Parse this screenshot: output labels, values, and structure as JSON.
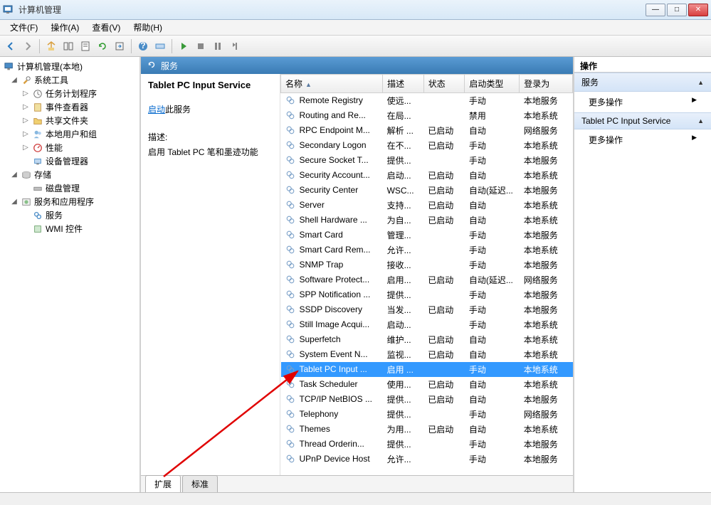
{
  "window": {
    "title": "计算机管理"
  },
  "menu": {
    "file": "文件(F)",
    "action": "操作(A)",
    "view": "查看(V)",
    "help": "帮助(H)"
  },
  "tree": {
    "root": "计算机管理(本地)",
    "system_tools": "系统工具",
    "task_scheduler": "任务计划程序",
    "event_viewer": "事件查看器",
    "shared_folders": "共享文件夹",
    "local_users": "本地用户和组",
    "performance": "性能",
    "device_manager": "设备管理器",
    "storage": "存储",
    "disk_mgmt": "磁盘管理",
    "services_apps": "服务和应用程序",
    "services": "服务",
    "wmi": "WMI 控件"
  },
  "center": {
    "header": "服务",
    "selected_title": "Tablet PC Input Service",
    "start_link": "启动",
    "start_suffix": "此服务",
    "desc_label": "描述:",
    "desc_text": "启用 Tablet PC 笔和墨迹功能"
  },
  "columns": {
    "name": "名称",
    "desc": "描述",
    "status": "状态",
    "startup": "启动类型",
    "logon": "登录为"
  },
  "services": [
    {
      "name": "Remote Registry",
      "desc": "使远...",
      "status": "",
      "startup": "手动",
      "logon": "本地服务",
      "sel": false
    },
    {
      "name": "Routing and Re...",
      "desc": "在局...",
      "status": "",
      "startup": "禁用",
      "logon": "本地系统",
      "sel": false
    },
    {
      "name": "RPC Endpoint M...",
      "desc": "解析 ...",
      "status": "已启动",
      "startup": "自动",
      "logon": "网络服务",
      "sel": false
    },
    {
      "name": "Secondary Logon",
      "desc": "在不...",
      "status": "已启动",
      "startup": "手动",
      "logon": "本地系统",
      "sel": false
    },
    {
      "name": "Secure Socket T...",
      "desc": "提供...",
      "status": "",
      "startup": "手动",
      "logon": "本地服务",
      "sel": false
    },
    {
      "name": "Security Account...",
      "desc": "启动...",
      "status": "已启动",
      "startup": "自动",
      "logon": "本地系统",
      "sel": false
    },
    {
      "name": "Security Center",
      "desc": "WSC...",
      "status": "已启动",
      "startup": "自动(延迟...",
      "logon": "本地服务",
      "sel": false
    },
    {
      "name": "Server",
      "desc": "支持...",
      "status": "已启动",
      "startup": "自动",
      "logon": "本地系统",
      "sel": false
    },
    {
      "name": "Shell Hardware ...",
      "desc": "为自...",
      "status": "已启动",
      "startup": "自动",
      "logon": "本地系统",
      "sel": false
    },
    {
      "name": "Smart Card",
      "desc": "管理...",
      "status": "",
      "startup": "手动",
      "logon": "本地服务",
      "sel": false
    },
    {
      "name": "Smart Card Rem...",
      "desc": "允许...",
      "status": "",
      "startup": "手动",
      "logon": "本地系统",
      "sel": false
    },
    {
      "name": "SNMP Trap",
      "desc": "接收...",
      "status": "",
      "startup": "手动",
      "logon": "本地服务",
      "sel": false
    },
    {
      "name": "Software Protect...",
      "desc": "启用...",
      "status": "已启动",
      "startup": "自动(延迟...",
      "logon": "网络服务",
      "sel": false
    },
    {
      "name": "SPP Notification ...",
      "desc": "提供...",
      "status": "",
      "startup": "手动",
      "logon": "本地服务",
      "sel": false
    },
    {
      "name": "SSDP Discovery",
      "desc": "当发...",
      "status": "已启动",
      "startup": "手动",
      "logon": "本地服务",
      "sel": false
    },
    {
      "name": "Still Image Acqui...",
      "desc": "启动...",
      "status": "",
      "startup": "手动",
      "logon": "本地系统",
      "sel": false
    },
    {
      "name": "Superfetch",
      "desc": "维护...",
      "status": "已启动",
      "startup": "自动",
      "logon": "本地系统",
      "sel": false
    },
    {
      "name": "System Event N...",
      "desc": "监视...",
      "status": "已启动",
      "startup": "自动",
      "logon": "本地系统",
      "sel": false
    },
    {
      "name": "Tablet PC Input ...",
      "desc": "启用 ...",
      "status": "",
      "startup": "手动",
      "logon": "本地系统",
      "sel": true
    },
    {
      "name": "Task Scheduler",
      "desc": "使用...",
      "status": "已启动",
      "startup": "自动",
      "logon": "本地系统",
      "sel": false
    },
    {
      "name": "TCP/IP NetBIOS ...",
      "desc": "提供...",
      "status": "已启动",
      "startup": "自动",
      "logon": "本地服务",
      "sel": false
    },
    {
      "name": "Telephony",
      "desc": "提供...",
      "status": "",
      "startup": "手动",
      "logon": "网络服务",
      "sel": false
    },
    {
      "name": "Themes",
      "desc": "为用...",
      "status": "已启动",
      "startup": "自动",
      "logon": "本地系统",
      "sel": false
    },
    {
      "name": "Thread Orderin...",
      "desc": "提供...",
      "status": "",
      "startup": "手动",
      "logon": "本地服务",
      "sel": false
    },
    {
      "name": "UPnP Device Host",
      "desc": "允许...",
      "status": "",
      "startup": "手动",
      "logon": "本地服务",
      "sel": false
    }
  ],
  "tabs": {
    "extended": "扩展",
    "standard": "标准"
  },
  "actions": {
    "header": "操作",
    "services_head": "服务",
    "more_actions": "更多操作",
    "selected_head": "Tablet PC Input Service"
  }
}
